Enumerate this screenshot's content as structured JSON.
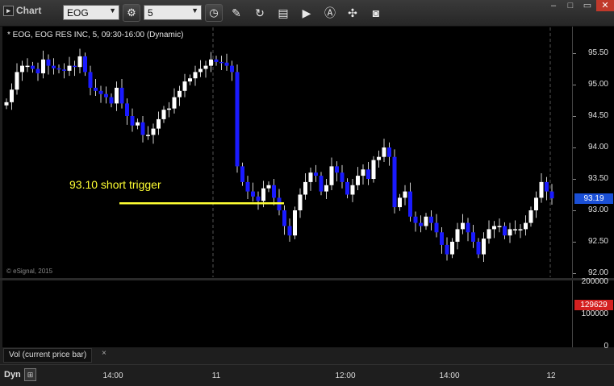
{
  "app": {
    "title": "Chart"
  },
  "toolbar": {
    "symbol": "EOG",
    "interval": "5",
    "buttons": [
      {
        "name": "settings-icon",
        "glyph": "⚙"
      },
      {
        "name": "clock-icon",
        "glyph": "◷"
      },
      {
        "name": "pencil-icon",
        "glyph": "✎"
      },
      {
        "name": "refresh-icon",
        "glyph": "↻"
      },
      {
        "name": "studies-icon",
        "glyph": "▤"
      },
      {
        "name": "play-icon",
        "glyph": "▶"
      },
      {
        "name": "alert-icon",
        "glyph": "A"
      },
      {
        "name": "link-icon",
        "glyph": "✣"
      },
      {
        "name": "camera-icon",
        "glyph": "◙"
      }
    ]
  },
  "chart": {
    "info": "* EOG, EOG RES INC, 5, 09:30-16:00 (Dynamic)",
    "copyright": "© eSignal, 2015",
    "annotation": "93.10 short trigger",
    "last_price": "93.19",
    "last_volume": "129629",
    "volume_label": "Vol (current price bar)",
    "volume_close": "×",
    "dyn_label": "Dyn",
    "colors": {
      "up": "#ffffff",
      "down": "#1a1aff",
      "vol_up": "#39c42a",
      "vol_down": "#d42020",
      "trigger": "#ffff33"
    }
  },
  "chart_data": {
    "type": "candlestick",
    "price_ticks": [
      "95.50",
      "95.00",
      "94.50",
      "94.00",
      "93.50",
      "93.00",
      "92.50",
      "92.00"
    ],
    "volume_ticks": [
      "200000",
      "100000",
      "0"
    ],
    "time_ticks": [
      "14:00",
      "11",
      "12:00",
      "14:00",
      "12"
    ],
    "trigger_price": 93.1,
    "close_series": [
      94.72,
      94.92,
      95.2,
      95.3,
      95.3,
      95.25,
      95.18,
      95.4,
      95.3,
      95.26,
      95.24,
      95.22,
      95.3,
      95.28,
      95.45,
      95.2,
      94.95,
      94.9,
      94.85,
      94.8,
      94.7,
      94.95,
      94.7,
      94.5,
      94.35,
      94.4,
      94.2,
      94.2,
      94.3,
      94.45,
      94.6,
      94.62,
      94.8,
      94.9,
      95.05,
      95.1,
      95.2,
      95.25,
      95.3,
      95.4,
      95.36,
      95.35,
      95.3,
      95.2,
      93.7,
      93.45,
      93.3,
      93.22,
      93.15,
      93.35,
      93.4,
      93.2,
      93.0,
      92.75,
      92.6,
      93.0,
      93.25,
      93.45,
      93.6,
      93.55,
      93.3,
      93.4,
      93.7,
      93.6,
      93.45,
      93.25,
      93.4,
      93.55,
      93.65,
      93.5,
      93.8,
      93.85,
      94.0,
      93.85,
      93.05,
      93.2,
      93.3,
      92.9,
      92.8,
      92.75,
      92.9,
      92.8,
      92.65,
      92.45,
      92.3,
      92.5,
      92.7,
      92.8,
      92.65,
      92.5,
      92.3,
      92.55,
      92.7,
      92.75,
      92.75,
      92.6,
      92.7,
      92.7,
      92.7,
      92.8,
      93.0,
      93.2,
      93.45,
      93.3,
      93.19
    ],
    "volume_series": [
      20,
      25,
      15,
      30,
      18,
      22,
      16,
      20,
      28,
      15,
      18,
      20,
      15,
      25,
      12,
      30,
      22,
      18,
      15,
      20,
      16,
      35,
      20,
      14,
      18,
      22,
      20,
      16,
      15,
      22,
      18,
      14,
      16,
      20,
      25,
      18,
      12,
      15,
      22,
      18,
      20,
      15,
      18,
      14,
      30,
      50,
      45,
      40,
      35,
      38,
      42,
      30,
      25,
      55,
      48,
      40,
      60,
      45,
      35,
      40,
      50,
      45,
      72,
      40,
      55,
      38,
      44,
      48,
      50,
      30,
      58,
      42,
      46,
      40,
      42,
      38,
      30,
      35,
      25,
      28,
      30,
      38,
      36,
      30,
      32,
      34,
      26,
      30,
      38,
      45,
      28,
      35,
      48,
      45,
      38,
      44,
      42,
      46,
      48,
      40,
      55,
      65,
      68,
      72,
      65
    ]
  }
}
